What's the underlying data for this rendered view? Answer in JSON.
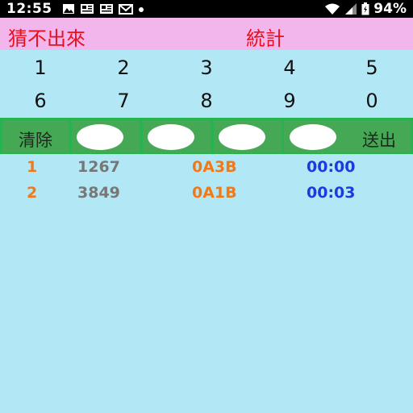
{
  "status": {
    "time": "12:55",
    "battery": "94%"
  },
  "header": {
    "title": "猜不出來",
    "stats_label": "統計"
  },
  "keypad": [
    "1",
    "2",
    "3",
    "4",
    "5",
    "6",
    "7",
    "8",
    "9",
    "0"
  ],
  "controls": {
    "clear_label": "清除",
    "submit_label": "送出"
  },
  "history": [
    {
      "index": "1",
      "guess": "1267",
      "result": "0A3B",
      "time": "00:00"
    },
    {
      "index": "2",
      "guess": "3849",
      "result": "0A1B",
      "time": "00:03"
    }
  ],
  "colors": {
    "background": "#b2e8f6",
    "header": "#f2b5ec",
    "title_text": "#e8101c",
    "bar": "#27b34f",
    "index_text": "#f07a1a",
    "time_text": "#1a3be0"
  }
}
